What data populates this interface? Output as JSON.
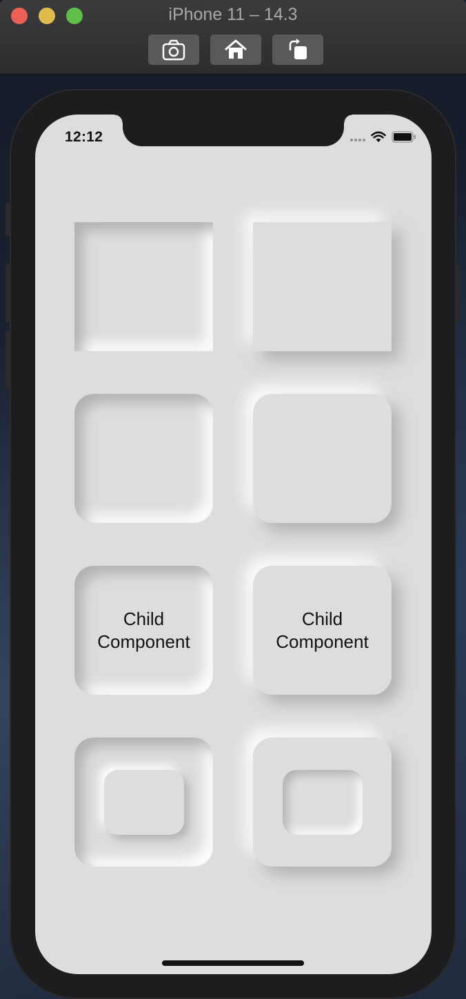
{
  "window": {
    "title": "iPhone 11 – 14.3",
    "controls": [
      "close-button",
      "minimize-button",
      "zoom-button"
    ],
    "toolbar": [
      {
        "name": "screenshot-button",
        "icon": "camera-icon"
      },
      {
        "name": "home-button",
        "icon": "home-icon"
      },
      {
        "name": "rotate-button",
        "icon": "rotate-icon"
      }
    ]
  },
  "status_bar": {
    "time": "12:12",
    "icons": [
      "cellular-signal-icon",
      "wifi-icon",
      "battery-icon"
    ]
  },
  "colors": {
    "screen_background": "#dddddd",
    "shadow_dark": "#a3a3a3",
    "shadow_light": "#ffffff",
    "traffic_close": "#ec5f57",
    "traffic_minimize": "#e0bd4b",
    "traffic_zoom": "#5fc049"
  },
  "tiles": [
    {
      "row": 1,
      "style": "concave",
      "shape": "square",
      "label": ""
    },
    {
      "row": 1,
      "style": "convex",
      "shape": "square",
      "label": ""
    },
    {
      "row": 2,
      "style": "concave",
      "shape": "rounded",
      "label": ""
    },
    {
      "row": 2,
      "style": "convex",
      "shape": "rounded",
      "label": ""
    },
    {
      "row": 3,
      "style": "concave",
      "shape": "rounded",
      "label": "Child\nComponent"
    },
    {
      "row": 3,
      "style": "convex",
      "shape": "rounded",
      "label": "Child\nComponent"
    },
    {
      "row": 4,
      "style": "concave",
      "shape": "rounded",
      "label": "",
      "child": "convex"
    },
    {
      "row": 4,
      "style": "convex",
      "shape": "rounded",
      "label": "",
      "child": "concave"
    }
  ]
}
